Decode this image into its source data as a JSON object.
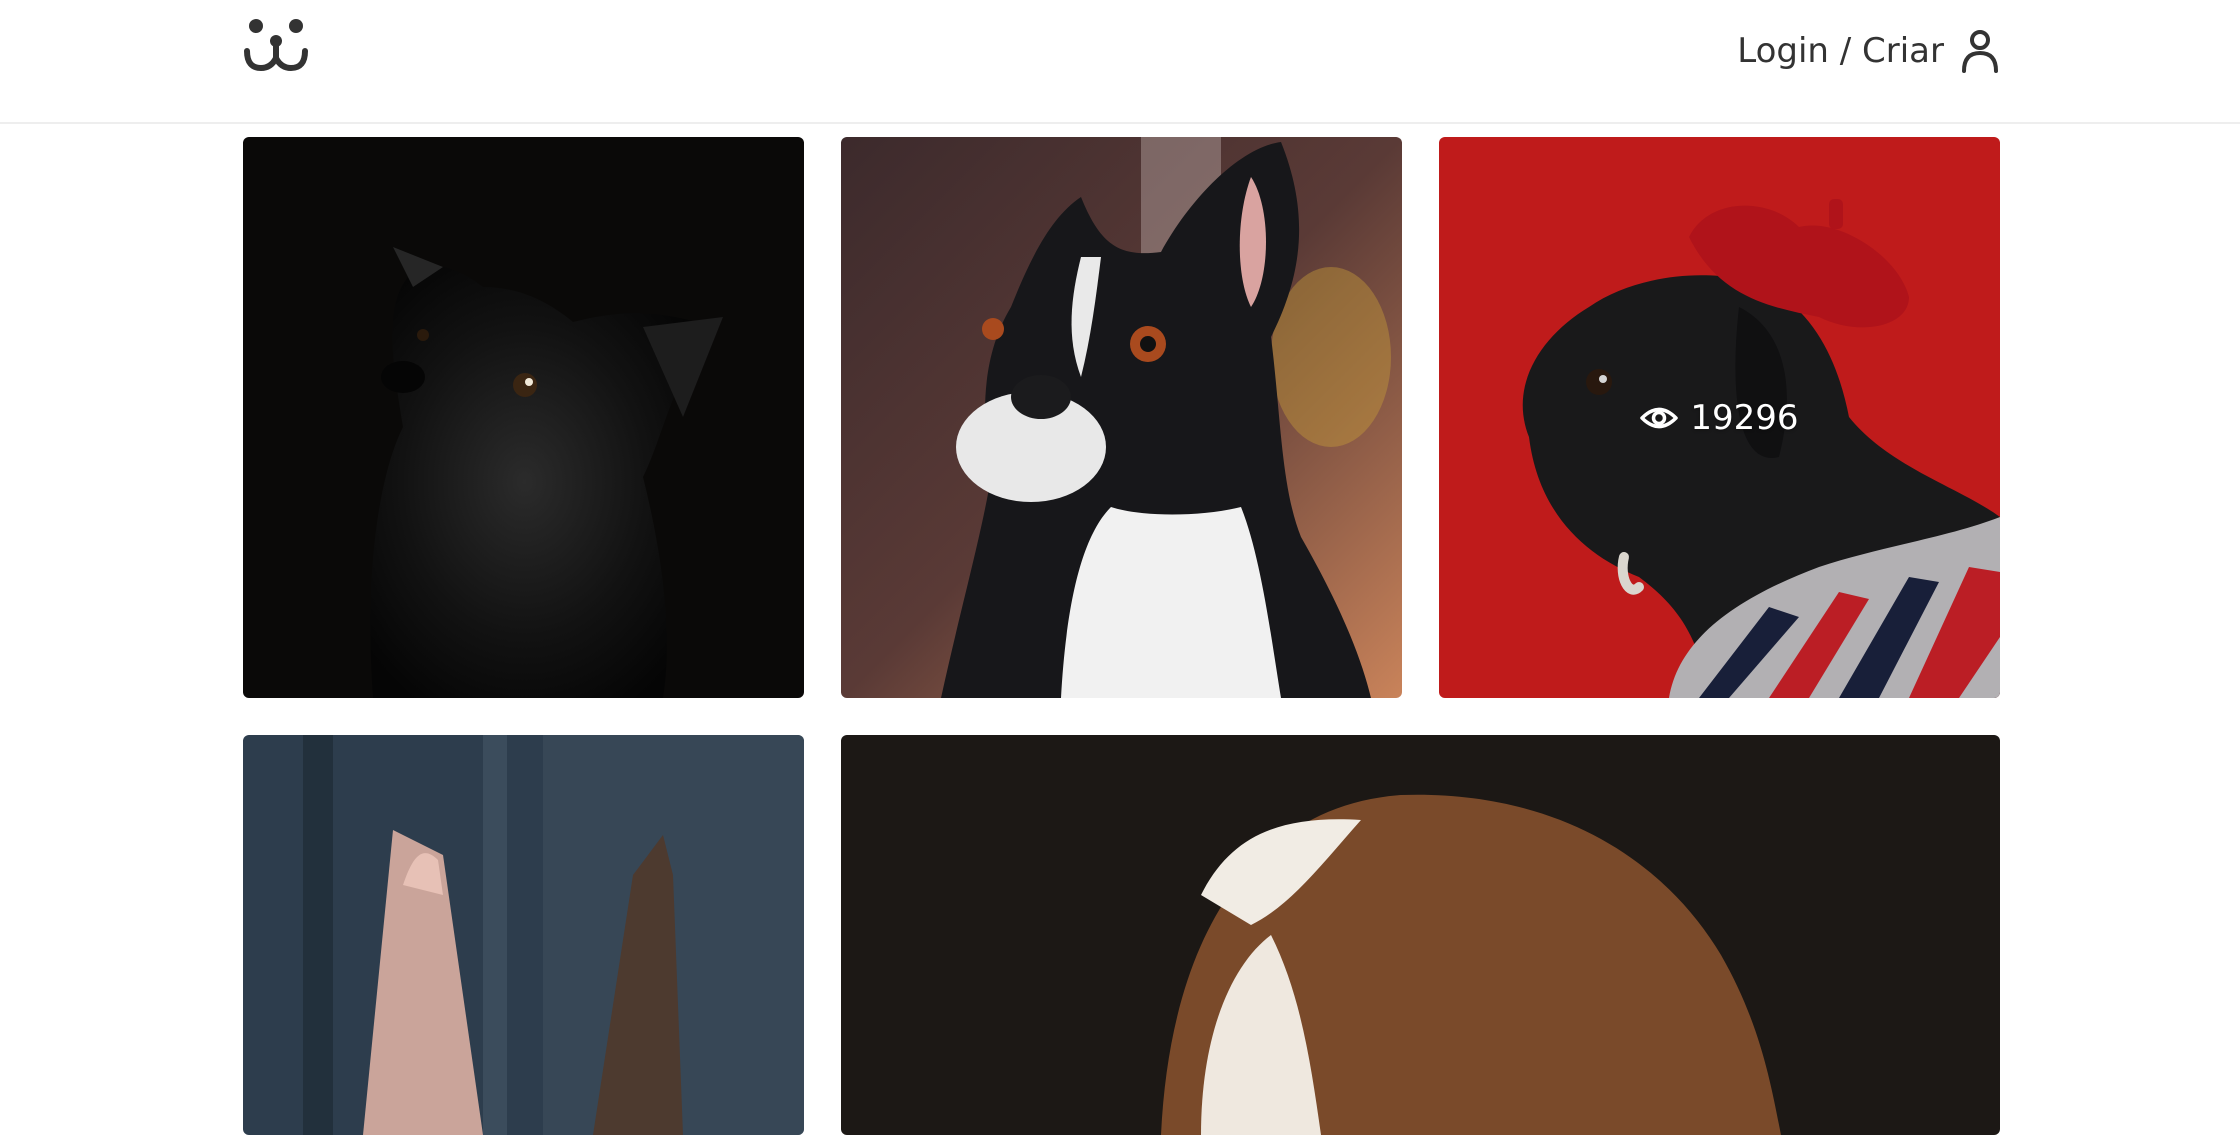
{
  "header": {
    "logo_icon": "dog-face-icon",
    "login_label": "Login / Criar",
    "user_icon": "user-icon"
  },
  "feed": {
    "photos": [
      {
        "subject": "black-dog-photo",
        "views": ""
      },
      {
        "subject": "boston-terrier-photo",
        "views": ""
      },
      {
        "subject": "pug-beret-photo",
        "views": "19296",
        "hovered": true
      },
      {
        "subject": "dog-photo",
        "views": ""
      },
      {
        "subject": "puppy-photo",
        "views": ""
      }
    ]
  },
  "colors": {
    "text": "#333333",
    "accent_red": "#d51f1f",
    "header_border": "#eeeeee"
  }
}
